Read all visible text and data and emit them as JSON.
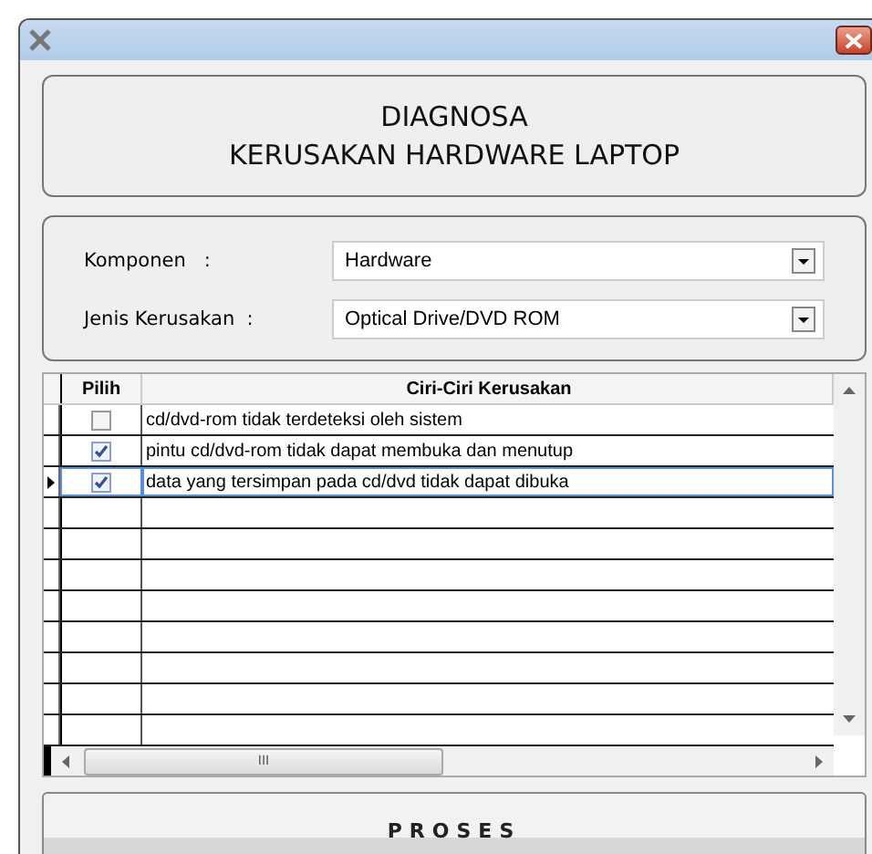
{
  "header": {
    "lines": [
      "DIAGNOSA",
      "KERUSAKAN HARDWARE LAPTOP"
    ]
  },
  "fields": [
    {
      "label": "Komponen   :",
      "value": "Hardware"
    },
    {
      "label": "Jenis Kerusakan  :",
      "value": "Optical Drive/DVD ROM"
    }
  ],
  "table": {
    "columns": [
      "Pilih",
      "Ciri-Ciri Kerusakan"
    ],
    "rows": [
      {
        "checked": false,
        "text": "cd/dvd-rom tidak terdeteksi oleh sistem",
        "selected": false
      },
      {
        "checked": true,
        "text": "pintu cd/dvd-rom tidak dapat membuka dan menutup",
        "selected": false
      },
      {
        "checked": true,
        "text": "data yang tersimpan pada cd/dvd tidak dapat dibuka",
        "selected": true
      }
    ],
    "scroll_thumb": "III"
  },
  "button": "PROSES"
}
